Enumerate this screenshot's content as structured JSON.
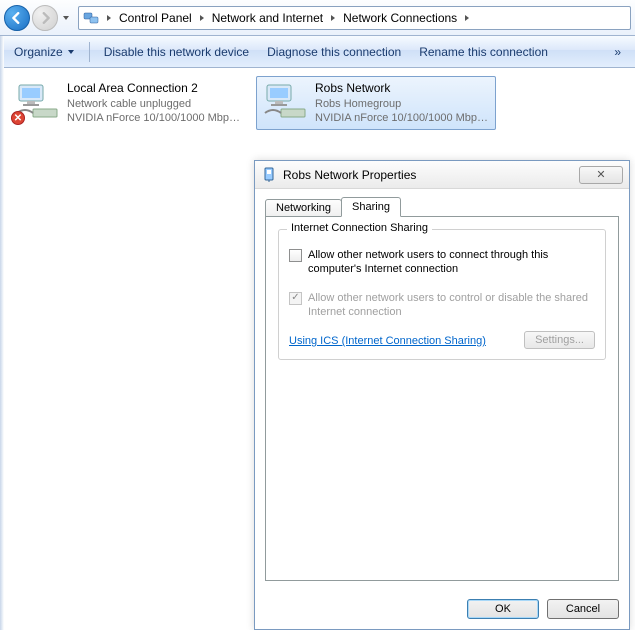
{
  "breadcrumbs": {
    "items": [
      "Control Panel",
      "Network and Internet",
      "Network Connections"
    ]
  },
  "toolbar": {
    "organize": "Organize",
    "disable": "Disable this network device",
    "diagnose": "Diagnose this connection",
    "rename": "Rename this connection",
    "more": "»"
  },
  "connections": [
    {
      "name": "Local Area Connection 2",
      "status": "Network cable unplugged",
      "device": "NVIDIA nForce 10/100/1000 Mbps...",
      "error": true,
      "selected": false
    },
    {
      "name": "Robs Network",
      "status": "Robs Homegroup",
      "device": "NVIDIA nForce 10/100/1000 Mbps...",
      "error": false,
      "selected": true
    }
  ],
  "dialog": {
    "title": "Robs Network Properties",
    "close": "✕",
    "tabs": {
      "networking": "Networking",
      "sharing": "Sharing"
    },
    "group_title": "Internet Connection Sharing",
    "chk1": "Allow other network users to connect through this computer's Internet connection",
    "chk2": "Allow other network users to control or disable the shared Internet connection",
    "link": "Using ICS (Internet Connection Sharing)",
    "settings": "Settings...",
    "ok": "OK",
    "cancel": "Cancel"
  }
}
